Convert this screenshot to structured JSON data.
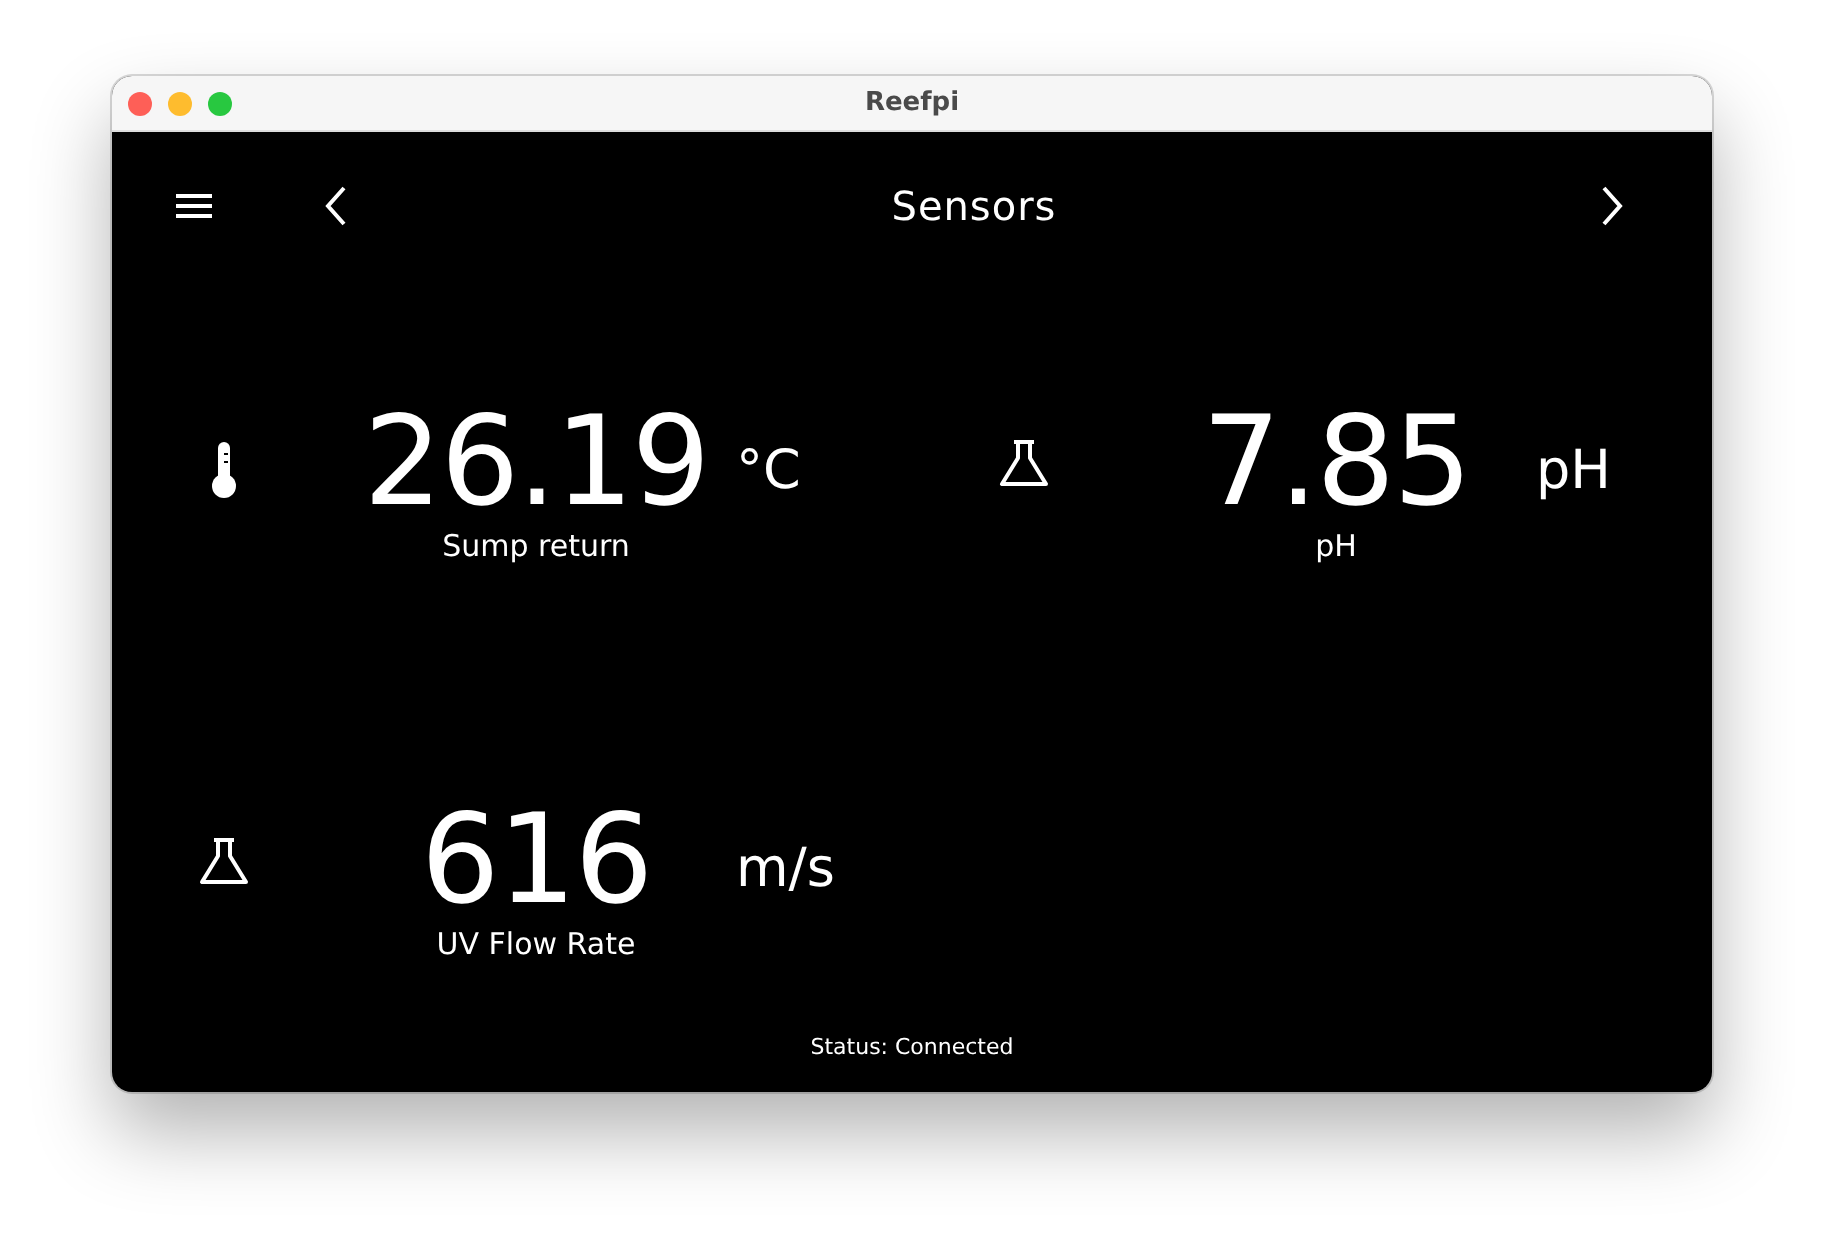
{
  "window": {
    "title": "Reefpi"
  },
  "header": {
    "title": "Sensors"
  },
  "sensors": [
    {
      "kind": "thermometer",
      "value": "26.19",
      "unit": "°C",
      "label": "Sump return"
    },
    {
      "kind": "flask",
      "value": "7.85",
      "unit": "pH",
      "label": "pH"
    },
    {
      "kind": "flask",
      "value": "616",
      "unit": "m/s",
      "label": "UV Flow Rate"
    }
  ],
  "status_bar": "Status: Connected"
}
